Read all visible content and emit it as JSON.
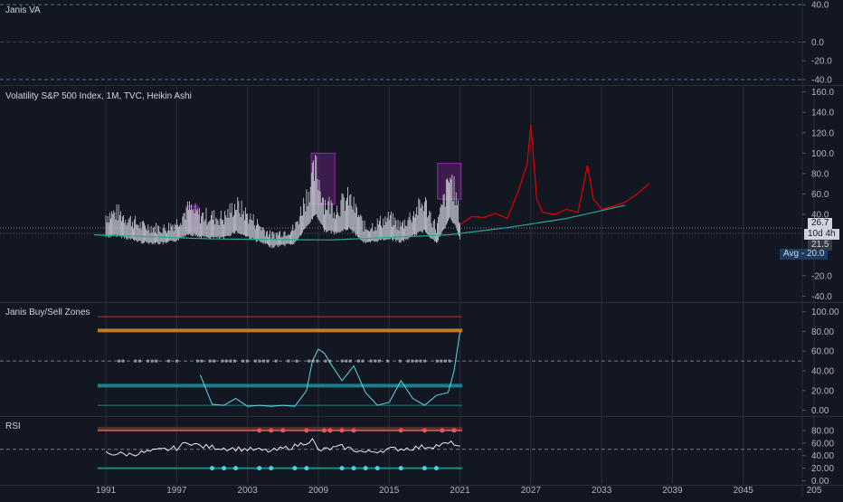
{
  "panes": {
    "va": {
      "title": "Janis VA",
      "ticks": [
        "40.0",
        "0.0",
        "-20.0",
        "-40.0"
      ]
    },
    "main": {
      "title": "Volatility S&P 500 Index, 1M, TVC, Heikin Ashi",
      "ticks": [
        "160.0",
        "140.0",
        "120.0",
        "100.0",
        "80.0",
        "60.0",
        "40.0",
        "-20.0",
        "-40.0"
      ],
      "badges": {
        "price": "26.7",
        "countdown": "10d 4h",
        "level": "21.5",
        "avg": "Avg - 20.0"
      }
    },
    "zones": {
      "title": "Janis Buy/Sell Zones",
      "ticks": [
        "100.00",
        "80.00",
        "60.00",
        "40.00",
        "20.00",
        "0.00"
      ]
    },
    "rsi": {
      "title": "RSI",
      "ticks": [
        "80.00",
        "60.00",
        "40.00",
        "20.00",
        "0.00"
      ]
    }
  },
  "time_axis": [
    "1991",
    "1997",
    "2003",
    "2009",
    "2015",
    "2021",
    "2027",
    "2033",
    "2039",
    "2045",
    "205"
  ],
  "colors": {
    "background": "#131722",
    "candles": "#d1d4dc",
    "projection": "#d50000",
    "trend": "#26a69a",
    "highlight": "#9c27b0",
    "orange": "#c17a2a",
    "teal": "#1e7f8c",
    "red_line": "#b23a3a",
    "oscillator": "#5ed7e4",
    "rsi_dot_red": "#ef5350",
    "rsi_dot_teal": "#4dd0e1",
    "badge_blue": "#2962ff"
  },
  "chart_data": [
    {
      "type": "line",
      "title": "Volatility S&P 500 Index, 1M, TVC, Heikin Ashi",
      "xlim": [
        1990,
        2050
      ],
      "ylim": [
        -45,
        165
      ],
      "series": [
        {
          "values_note_free": true,
          "x": [
            1990,
            1992,
            1994,
            1996,
            1997,
            1998,
            1999,
            2001,
            2002,
            2003,
            2005,
            2007,
            2008,
            2008.8,
            2009.5,
            2010.5,
            2011.6,
            2013,
            2015,
            2016,
            2018,
            2019,
            2020.2,
            2020.6,
            2021
          ],
          "values": [
            28,
            32,
            22,
            20,
            25,
            35,
            30,
            28,
            38,
            30,
            15,
            20,
            45,
            65,
            40,
            35,
            43,
            20,
            28,
            22,
            40,
            20,
            60,
            45,
            26.7
          ]
        },
        {
          "x": [
            2021,
            2022,
            2023,
            2024,
            2025,
            2026,
            2026.7,
            2027,
            2027.5,
            2028,
            2029,
            2030,
            2031,
            2031.8,
            2032.3,
            2033,
            2034,
            2035,
            2036,
            2037
          ],
          "values": [
            30,
            38,
            37,
            41,
            36,
            65,
            90,
            128,
            55,
            42,
            40,
            45,
            42,
            88,
            55,
            45,
            48,
            52,
            60,
            70
          ]
        },
        {
          "x": [
            1990,
            2000,
            2010,
            2020,
            2025,
            2030,
            2035
          ],
          "values": [
            20,
            16,
            15,
            20,
            27,
            36,
            49
          ]
        }
      ],
      "highlight_ranges": [
        {
          "x": [
            1997.8,
            1998.8
          ],
          "y": [
            24,
            48
          ]
        },
        {
          "x": [
            2008.4,
            2010.4
          ],
          "y": [
            50,
            100
          ]
        },
        {
          "x": [
            2019.1,
            2021.1
          ],
          "y": [
            55,
            90
          ]
        }
      ],
      "grid": true,
      "legend": "none"
    },
    {
      "type": "line",
      "title": "Janis Buy/Sell Zones",
      "xlim": [
        1990,
        2050
      ],
      "ylim": [
        -5,
        105
      ],
      "levels": [
        95,
        81,
        25,
        5
      ],
      "series": [
        {
          "x": [
            1999,
            2000,
            2001,
            2002,
            2003,
            2004,
            2005,
            2006,
            2007,
            2008,
            2008.5,
            2009,
            2009.5,
            2010,
            2011,
            2012,
            2013,
            2014,
            2015,
            2016,
            2017,
            2018,
            2019,
            2020,
            2020.5,
            2021
          ],
          "values": [
            36,
            6,
            5,
            12,
            4,
            5,
            4,
            5,
            4,
            20,
            50,
            62,
            58,
            48,
            30,
            45,
            18,
            5,
            8,
            30,
            12,
            5,
            15,
            18,
            40,
            80
          ]
        }
      ],
      "legend": "none"
    },
    {
      "type": "line",
      "title": "RSI",
      "xlim": [
        1990,
        2050
      ],
      "ylim": [
        -5,
        100
      ],
      "levels": [
        80,
        20
      ],
      "series": [
        {
          "x": [
            1991,
            1993,
            1995,
            1997,
            1998,
            1999,
            2001,
            2003,
            2005,
            2007,
            2008.5,
            2009,
            2011,
            2013,
            2015,
            2017,
            2019,
            2020.5,
            2021
          ],
          "values": [
            44,
            42,
            47,
            52,
            62,
            55,
            52,
            50,
            47,
            55,
            65,
            48,
            54,
            45,
            50,
            52,
            56,
            60,
            52
          ]
        }
      ],
      "legend": "none"
    }
  ]
}
